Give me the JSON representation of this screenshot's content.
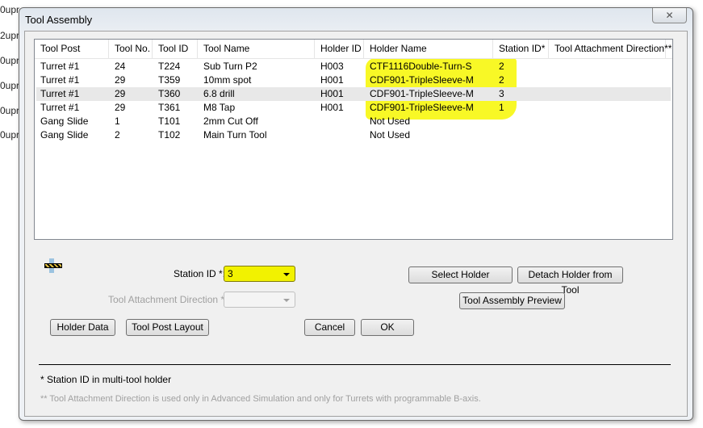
{
  "background_fragments": [
    "0upr",
    "2upr",
    "0upr",
    "0upr",
    "0upr",
    "0upr"
  ],
  "dialog": {
    "title": "Tool Assembly",
    "close_icon": "close-icon"
  },
  "table": {
    "columns": [
      "Tool Post",
      "Tool No.",
      "Tool ID",
      "Tool Name",
      "Holder ID",
      "Holder Name",
      "Station ID*",
      "Tool Attachment Direction**"
    ],
    "rows": [
      [
        "Turret #1",
        "24",
        "T224",
        "Sub Turn P2",
        "H003",
        "CTF1116Double-Turn-S",
        "2",
        ""
      ],
      [
        "Turret #1",
        "29",
        "T359",
        "10mm spot",
        "H001",
        "CDF901-TripleSleeve-M",
        "2",
        ""
      ],
      [
        "Turret #1",
        "29",
        "T360",
        "6.8 drill",
        "H001",
        "CDF901-TripleSleeve-M",
        "3",
        ""
      ],
      [
        "Turret #1",
        "29",
        "T361",
        "M8 Tap",
        "H001",
        "CDF901-TripleSleeve-M",
        "1",
        ""
      ],
      [
        "Gang Slide",
        "1",
        "T101",
        "2mm Cut Off",
        "",
        "Not Used",
        "",
        ""
      ],
      [
        "Gang Slide",
        "2",
        "T102",
        "Main Turn Tool",
        "",
        "Not Used",
        "",
        ""
      ]
    ],
    "selected_row": 2,
    "highlight_color": "#f7f700"
  },
  "form": {
    "holder_icon": "tool-holder-icon",
    "station_id_label": "Station ID *:",
    "station_id_value": "3",
    "attach_dir_label": "Tool Attachment Direction **:",
    "attach_dir_value": ""
  },
  "buttons": {
    "select_holder": "Select Holder",
    "detach_holder": "Detach Holder from Tool",
    "preview": "Tool Assembly Preview",
    "holder_data": "Holder Data",
    "tool_post_layout": "Tool Post Layout",
    "cancel": "Cancel",
    "ok": "OK"
  },
  "notes": {
    "station_note": "* Station ID in multi-tool holder",
    "attach_note": "** Tool Attachment Direction is used only in Advanced Simulation and only for Turrets with programmable B-axis."
  }
}
